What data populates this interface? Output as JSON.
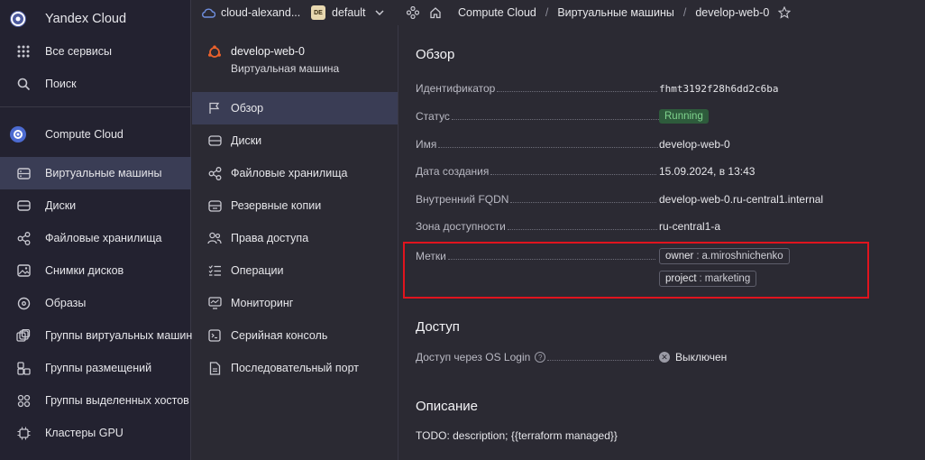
{
  "sidebar": {
    "brand": "Yandex Cloud",
    "all_services": "Все сервисы",
    "search": "Поиск",
    "service": "Compute Cloud",
    "items": [
      {
        "label": "Виртуальные машины"
      },
      {
        "label": "Диски"
      },
      {
        "label": "Файловые хранилища"
      },
      {
        "label": "Снимки дисков"
      },
      {
        "label": "Образы"
      },
      {
        "label": "Группы виртуальных машин"
      },
      {
        "label": "Группы размещений"
      },
      {
        "label": "Группы выделенных хостов"
      },
      {
        "label": "Кластеры GPU"
      }
    ]
  },
  "topbar": {
    "cloud": "cloud-alexand...",
    "folder_badge": "DE",
    "folder": "default",
    "crumbs": [
      "Compute Cloud",
      "Виртуальные машины",
      "develop-web-0"
    ]
  },
  "vm": {
    "name": "develop-web-0",
    "type": "Виртуальная машина"
  },
  "subnav": [
    {
      "label": "Обзор"
    },
    {
      "label": "Диски"
    },
    {
      "label": "Файловые хранилища"
    },
    {
      "label": "Резервные копии"
    },
    {
      "label": "Права доступа"
    },
    {
      "label": "Операции"
    },
    {
      "label": "Мониторинг"
    },
    {
      "label": "Серийная консоль"
    },
    {
      "label": "Последовательный порт"
    }
  ],
  "overview": {
    "heading": "Обзор",
    "id_label": "Идентификатор",
    "id_value": "fhmt3192f28h6dd2c6ba",
    "status_label": "Статус",
    "status_value": "Running",
    "name_label": "Имя",
    "name_value": "develop-web-0",
    "created_label": "Дата создания",
    "created_value": "15.09.2024, в 13:43",
    "fqdn_label": "Внутренний FQDN",
    "fqdn_value": "develop-web-0.ru-central1.internal",
    "zone_label": "Зона доступности",
    "zone_value": "ru-central1-a",
    "labels_label": "Метки",
    "tags": [
      {
        "key": "owner",
        "sep": ":",
        "value": "a.miroshnichenko"
      },
      {
        "key": "project",
        "sep": ":",
        "value": "marketing"
      }
    ]
  },
  "access": {
    "heading": "Доступ",
    "oslogin_label": "Доступ через OS Login",
    "oslogin_value": "Выключен"
  },
  "description": {
    "heading": "Описание",
    "text": "TODO: description; {{terraform managed}}"
  },
  "colors": {
    "accent_active": "#3a3d55",
    "status_green": "#7fd38d",
    "highlight": "#e0141e"
  }
}
